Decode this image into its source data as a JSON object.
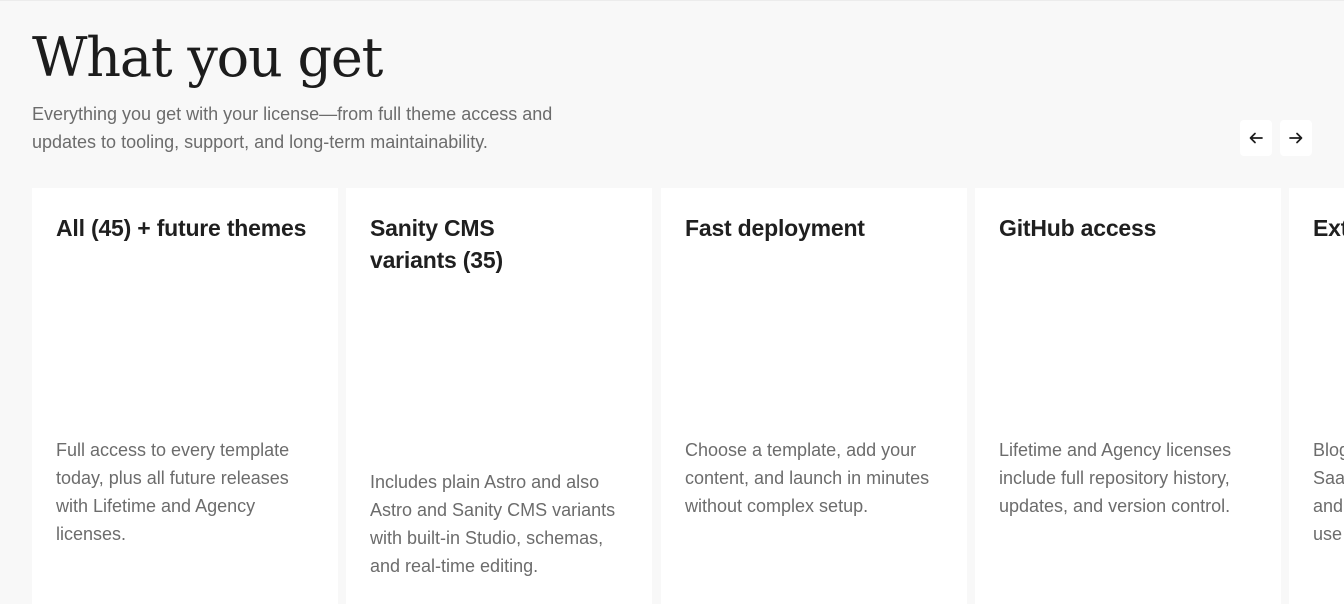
{
  "section": {
    "title": "What you get",
    "intro": "Everything you get with your license—from full theme access and updates to tooling, support, and long-term maintainability."
  },
  "carousel": {
    "prev_icon": "arrow-left-icon",
    "next_icon": "arrow-right-icon",
    "cards": [
      {
        "title": "All (45) + future themes",
        "description": "Full access to every template today, plus all future releases with Lifetime and Agency licenses."
      },
      {
        "title": "Sanity CMS variants (35)",
        "description": "Includes plain Astro and also Astro and Sanity CMS variants with built-in Studio, schemas, and real-time editing."
      },
      {
        "title": "Fast deployment",
        "description": "Choose a template, add your content, and launch in minutes without complex setup."
      },
      {
        "title": "GitHub access",
        "description": "Lifetime and Agency licenses include full repository history, updates, and version control."
      },
      {
        "title": "Ext",
        "description": "Blog SaaS and use"
      }
    ]
  },
  "colors": {
    "page_background": "#f8f8f8",
    "card_background": "#ffffff",
    "heading_text": "#1c1c1c",
    "body_text": "#6c6c6c"
  }
}
